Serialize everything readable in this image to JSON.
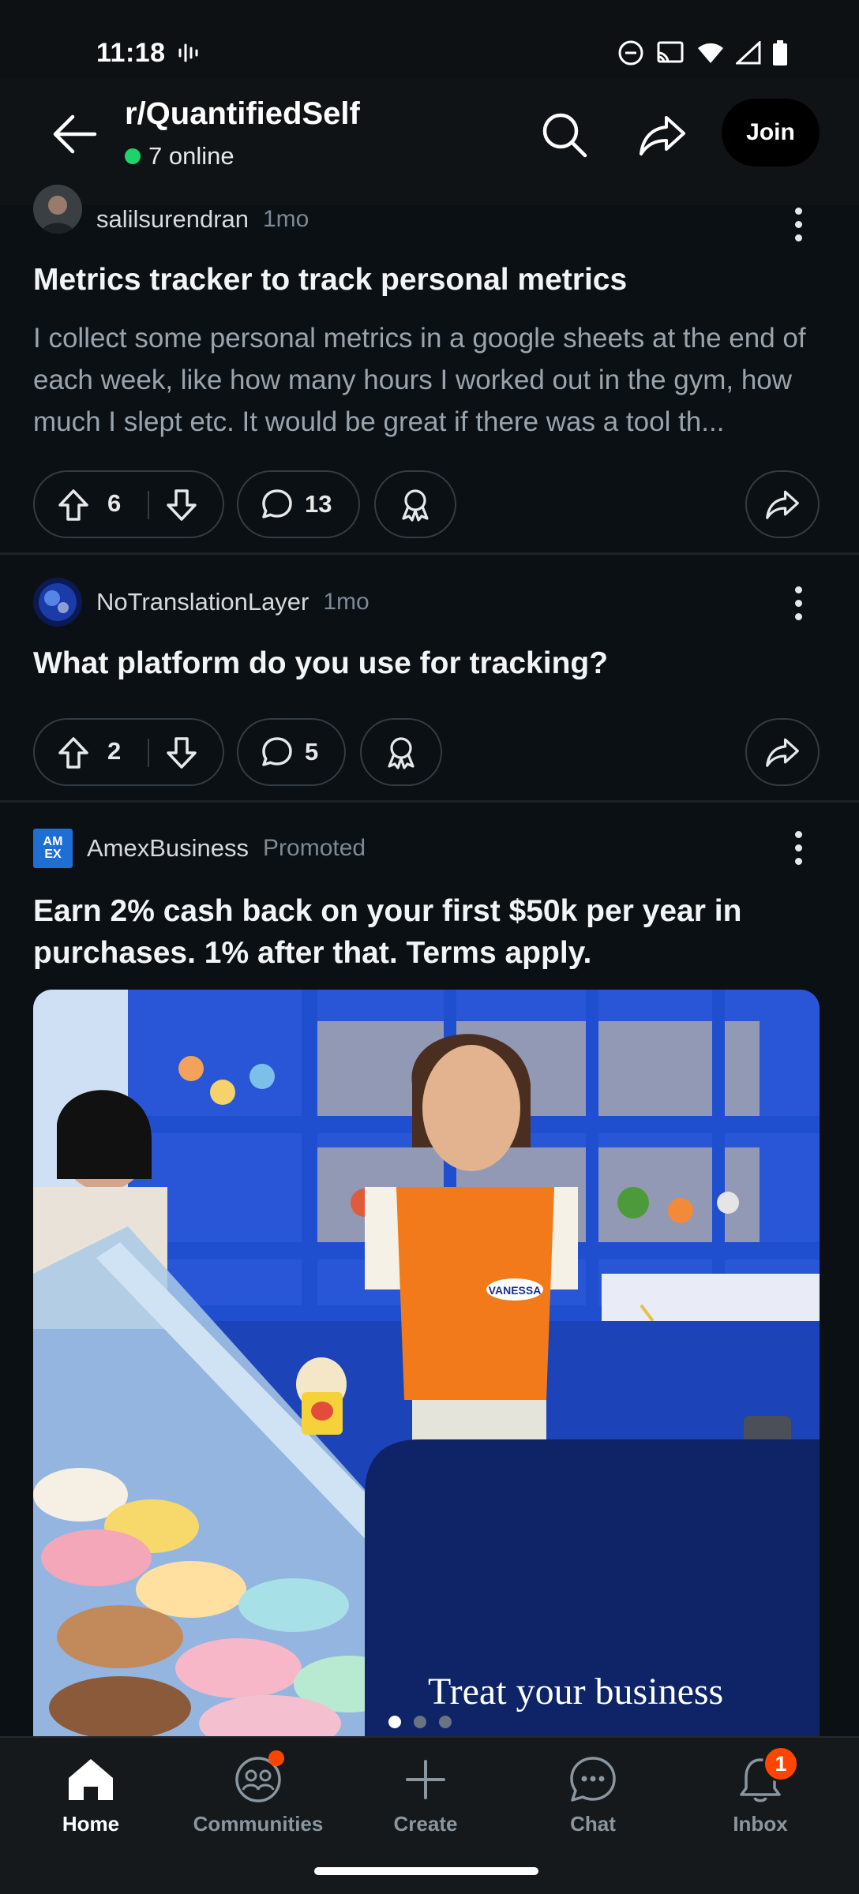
{
  "status_bar": {
    "time": "11:18"
  },
  "header": {
    "subreddit": "r/QuantifiedSelf",
    "online": "7 online",
    "join_label": "Join"
  },
  "posts": [
    {
      "author": "salilsurendran",
      "age": "1mo",
      "title": "Metrics tracker to track personal metrics",
      "body": "I collect some personal metrics in a google sheets at the end of each week, like how many hours I worked out in the gym, how much I slept etc. It would be great if there was a tool th...",
      "votes": "6",
      "comments": "13"
    },
    {
      "author": "NoTranslationLayer",
      "age": "1mo",
      "title": "What platform do you use for tracking?",
      "votes": "2",
      "comments": "5"
    }
  ],
  "ad": {
    "advertiser": "AmexBusiness",
    "promoted_label": "Promoted",
    "logo_text": "AM EX",
    "title": "Earn 2% cash back on your first $50k per year in purchases. 1% after that. Terms apply.",
    "image_caption": "Treat your business",
    "name_tag": "VANESSA",
    "carousel_pages": 3,
    "carousel_active": 1
  },
  "bottom_nav": {
    "home": "Home",
    "communities": "Communities",
    "create": "Create",
    "chat": "Chat",
    "inbox": "Inbox",
    "inbox_badge": "1"
  },
  "colors": {
    "background": "#0b1014",
    "accent": "#ff4500",
    "online": "#1fd36b",
    "ad_blue": "#0e2466"
  }
}
